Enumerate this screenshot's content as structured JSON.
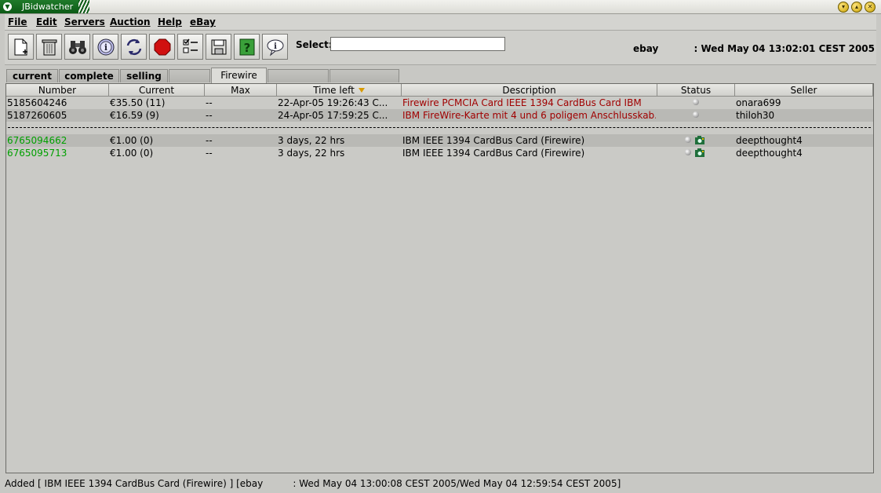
{
  "window": {
    "title": "JBidwatcher"
  },
  "menu": [
    "File",
    "Edit",
    "Servers",
    "Auction",
    "Help",
    "eBay"
  ],
  "toolbar": {
    "buttons": [
      {
        "icon": "new-document-icon"
      },
      {
        "icon": "trash-icon"
      },
      {
        "icon": "binoculars-icon"
      },
      {
        "icon": "info-icon"
      },
      {
        "icon": "refresh-icon"
      },
      {
        "icon": "stop-icon"
      },
      {
        "icon": "checklist-icon"
      },
      {
        "icon": "save-disk-icon"
      },
      {
        "icon": "help-icon"
      },
      {
        "icon": "speech-bubble-icon"
      }
    ],
    "select_label": "Select:",
    "select_value": "",
    "server": "ebay",
    "clock": ": Wed May 04 13:02:01 CEST 2005"
  },
  "tabs": [
    "current",
    "complete",
    "selling",
    "",
    "Firewire",
    "",
    ""
  ],
  "active_tab": "Firewire",
  "table": {
    "columns": [
      "Number",
      "Current",
      "Max",
      "Time left",
      "Description",
      "Status",
      "Seller"
    ],
    "sorted_column": "Time left",
    "rows": [
      {
        "number": "5185604246",
        "current": "€35.50 (11)",
        "max": "--",
        "time_left": "22-Apr-05 19:26:43 C...",
        "description": "Firewire PCMCIA Card IEEE 1394 CardBus Card IBM",
        "seller": "onara699",
        "status": "dot"
      },
      {
        "number": "5187260605",
        "current": "€16.59 (9)",
        "max": "--",
        "time_left": "24-Apr-05 17:59:25 C...",
        "description": "IBM FireWire-Karte mit 4 und 6 poligem Anschlusskab...",
        "seller": "thiloh30",
        "status": "dot"
      },
      {
        "number": "6765094662",
        "current": "€1.00 (0)",
        "max": "--",
        "time_left": "3 days, 22 hrs",
        "description": "IBM IEEE 1394 CardBus Card (Firewire)",
        "seller": "deepthought4",
        "status": "dot+camera"
      },
      {
        "number": "6765095713",
        "current": "€1.00 (0)",
        "max": "--",
        "time_left": "3 days, 22 hrs",
        "description": "IBM IEEE 1394 CardBus Card (Firewire)",
        "seller": "deepthought4",
        "status": "dot+camera"
      }
    ]
  },
  "colors": {
    "ended": "#a00000",
    "selling": "#00a000",
    "title_green": "#0c5a16"
  },
  "statusbar": {
    "text": "Added [ IBM IEEE 1394 CardBus Card (Firewire) ] [ebay          : Wed May 04 13:00:08 CEST 2005/Wed May 04 12:59:54 CEST 2005]"
  }
}
